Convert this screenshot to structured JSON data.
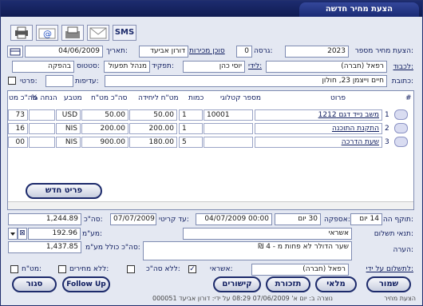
{
  "window": {
    "title": "הצעת מחיר חדשה"
  },
  "toolbar": {
    "sms_label": "SMS",
    "icons": [
      "sms-icon",
      "envelope-icon",
      "fax-icon",
      "email-icon",
      "print-icon"
    ]
  },
  "header": {
    "offer_no_label": "הצעת מחיר מספר:",
    "offer_no": "2023",
    "version_label": "גרסה:",
    "version": "0",
    "agent_label": "סוכן מכירות",
    "agent": "דורון אביעד",
    "date_label": "תאריך:",
    "date": "04/06/2009",
    "customer_label": "לכבוד:",
    "customer": "רפאל (חברה)",
    "contact_label": "לידי:",
    "contact": "יוסי כהן",
    "role_label": "תפקיד:",
    "role": "מנהל תפעול",
    "status_label": "סטטוס:",
    "status": "בהפקה",
    "address_label": "כתובת:",
    "address": "חיים וייצמן 23, חולון",
    "priority_label": "עדיפות:",
    "priority": "",
    "private_label": "פרטי:"
  },
  "grid": {
    "columns": [
      "#",
      "פרוט",
      "מספר קטלוגי",
      "כמות",
      "מט\"ח ליחידה",
      "סה\"כ מט\"ח",
      "מטבע",
      "% הנחה",
      "סה\"כ מט"
    ],
    "rows": [
      {
        "n": "1",
        "desc": "משב נייד דגם 1212",
        "catalog": "10001",
        "qty": "1",
        "unit": "50.00",
        "total": "50.00",
        "cur": "USD",
        "disc": "",
        "grand": "73"
      },
      {
        "n": "2",
        "desc": "התקנת התוכנה",
        "catalog": "",
        "qty": "1",
        "unit": "200.00",
        "total": "200.00",
        "cur": "NIS",
        "disc": "",
        "grand": "16"
      },
      {
        "n": "3",
        "desc": "שעת הדרכה",
        "catalog": "",
        "qty": "5",
        "unit": "180.00",
        "total": "900.00",
        "cur": "NIS",
        "disc": "",
        "grand": "00"
      }
    ],
    "new_item_label": "פריט חדש"
  },
  "summary": {
    "validity_label": "תוקף ההצעה:",
    "validity_days": "14 יום",
    "supply_label": "אספקה:",
    "supply_days": "30 יום",
    "supply_date": "04/07/2009 00:00",
    "until_label": "עד קריטי:",
    "until_date": "07/07/2009",
    "subtotal_label": "סה\"כ:",
    "subtotal": "1,244.89",
    "payment_label": "תנאי תשלום:",
    "payment": "אשראי",
    "vat_label": "מע\"מ:",
    "vat": "192.96",
    "vat_flag": "⊠",
    "total_label": "סה\"כ כולל מע\"מ:",
    "total": "1,437.85",
    "note_label": "הערה:",
    "note": "שער הדולר לא פחות מ - 4 ₪",
    "pay_for_label": "לתשלום על ידי:",
    "pay_for": "רפאל (חברה)",
    "credit_label": "אשראי:",
    "no_vat_label": "ללא סה\"כ:",
    "no_prices_label": "ללא מחירים:",
    "fx_label": "מט\"ח:"
  },
  "buttons": {
    "save": "שמור",
    "full": "מלאי",
    "reminder": "תזכורת",
    "links": "קישורים",
    "follow": "Follow Up",
    "close": "סגור"
  },
  "footer": {
    "meta": "000051 נוצרה ב: יום א' 07/06/2009 08:29 על ידי: דורון אביעד",
    "label": "הצעת מחיר"
  }
}
